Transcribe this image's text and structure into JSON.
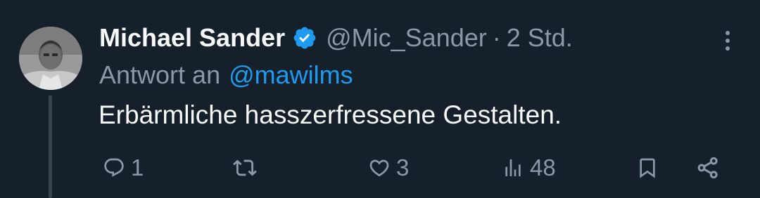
{
  "tweet": {
    "author": {
      "display_name": "Michael Sander",
      "handle": "@Mic_Sander",
      "verified": true
    },
    "separator": "·",
    "timestamp": "2 Std.",
    "reply_prefix": "Antwort an",
    "reply_handle": "@mawilms",
    "text": "Erbärmliche hasszerfressene Gestalten.",
    "actions": {
      "replies": "1",
      "retweets": "",
      "likes": "3",
      "views": "48"
    }
  },
  "colors": {
    "background": "#15202b",
    "primary_text": "#f7f9f9",
    "secondary_text": "#8b98a5",
    "accent": "#1d9bf0",
    "thread_line": "#38444d"
  },
  "icons": {
    "verified": "verified-badge-icon",
    "more": "more-vertical-icon",
    "reply": "reply-icon",
    "retweet": "retweet-icon",
    "like": "heart-icon",
    "views": "views-chart-icon",
    "bookmark": "bookmark-icon",
    "share": "share-icon"
  }
}
